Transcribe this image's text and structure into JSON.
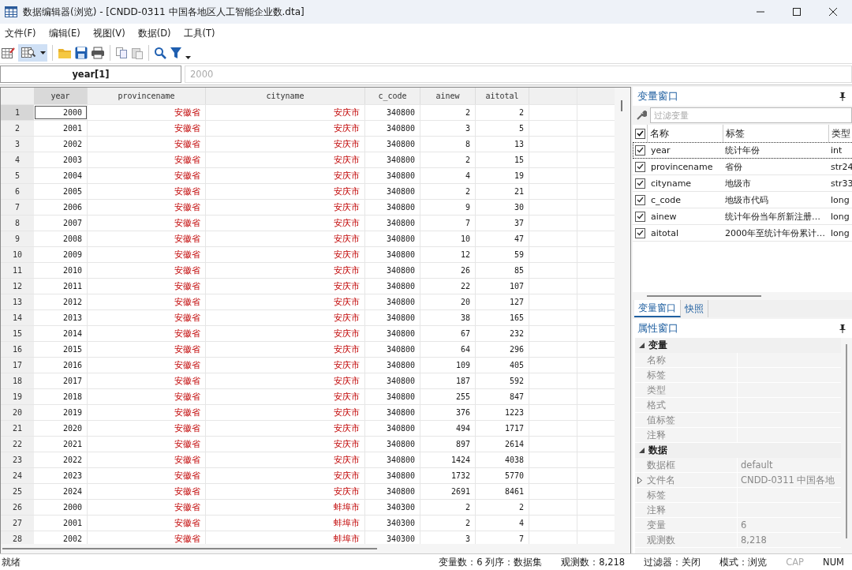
{
  "window": {
    "title": "数据编辑器(浏览) - [CNDD-0311 中国各地区人工智能企业数.dta]"
  },
  "menu": [
    "文件(F)",
    "编辑(E)",
    "视图(V)",
    "数据(D)",
    "工具(T)"
  ],
  "varbar": {
    "name": "year[1]",
    "value": "2000"
  },
  "grid": {
    "columns": [
      {
        "label": "year",
        "kind": "number",
        "selected": true
      },
      {
        "label": "provincename",
        "kind": "string",
        "selected": false
      },
      {
        "label": "cityname",
        "kind": "string",
        "selected": false
      },
      {
        "label": "c_code",
        "kind": "number",
        "selected": false
      },
      {
        "label": "ainew",
        "kind": "number",
        "selected": false
      },
      {
        "label": "aitotal",
        "kind": "number",
        "selected": false
      }
    ],
    "rows": [
      {
        "n": "1",
        "selected": true,
        "cells": [
          "2000",
          "安徽省",
          "安庆市",
          "340800",
          "2",
          "2"
        ]
      },
      {
        "n": "2",
        "selected": false,
        "cells": [
          "2001",
          "安徽省",
          "安庆市",
          "340800",
          "3",
          "5"
        ]
      },
      {
        "n": "3",
        "selected": false,
        "cells": [
          "2002",
          "安徽省",
          "安庆市",
          "340800",
          "8",
          "13"
        ]
      },
      {
        "n": "4",
        "selected": false,
        "cells": [
          "2003",
          "安徽省",
          "安庆市",
          "340800",
          "2",
          "15"
        ]
      },
      {
        "n": "5",
        "selected": false,
        "cells": [
          "2004",
          "安徽省",
          "安庆市",
          "340800",
          "4",
          "19"
        ]
      },
      {
        "n": "6",
        "selected": false,
        "cells": [
          "2005",
          "安徽省",
          "安庆市",
          "340800",
          "2",
          "21"
        ]
      },
      {
        "n": "7",
        "selected": false,
        "cells": [
          "2006",
          "安徽省",
          "安庆市",
          "340800",
          "9",
          "30"
        ]
      },
      {
        "n": "8",
        "selected": false,
        "cells": [
          "2007",
          "安徽省",
          "安庆市",
          "340800",
          "7",
          "37"
        ]
      },
      {
        "n": "9",
        "selected": false,
        "cells": [
          "2008",
          "安徽省",
          "安庆市",
          "340800",
          "10",
          "47"
        ]
      },
      {
        "n": "10",
        "selected": false,
        "cells": [
          "2009",
          "安徽省",
          "安庆市",
          "340800",
          "12",
          "59"
        ]
      },
      {
        "n": "11",
        "selected": false,
        "cells": [
          "2010",
          "安徽省",
          "安庆市",
          "340800",
          "26",
          "85"
        ]
      },
      {
        "n": "12",
        "selected": false,
        "cells": [
          "2011",
          "安徽省",
          "安庆市",
          "340800",
          "22",
          "107"
        ]
      },
      {
        "n": "13",
        "selected": false,
        "cells": [
          "2012",
          "安徽省",
          "安庆市",
          "340800",
          "20",
          "127"
        ]
      },
      {
        "n": "14",
        "selected": false,
        "cells": [
          "2013",
          "安徽省",
          "安庆市",
          "340800",
          "38",
          "165"
        ]
      },
      {
        "n": "15",
        "selected": false,
        "cells": [
          "2014",
          "安徽省",
          "安庆市",
          "340800",
          "67",
          "232"
        ]
      },
      {
        "n": "16",
        "selected": false,
        "cells": [
          "2015",
          "安徽省",
          "安庆市",
          "340800",
          "64",
          "296"
        ]
      },
      {
        "n": "17",
        "selected": false,
        "cells": [
          "2016",
          "安徽省",
          "安庆市",
          "340800",
          "109",
          "405"
        ]
      },
      {
        "n": "18",
        "selected": false,
        "cells": [
          "2017",
          "安徽省",
          "安庆市",
          "340800",
          "187",
          "592"
        ]
      },
      {
        "n": "19",
        "selected": false,
        "cells": [
          "2018",
          "安徽省",
          "安庆市",
          "340800",
          "255",
          "847"
        ]
      },
      {
        "n": "20",
        "selected": false,
        "cells": [
          "2019",
          "安徽省",
          "安庆市",
          "340800",
          "376",
          "1223"
        ]
      },
      {
        "n": "21",
        "selected": false,
        "cells": [
          "2020",
          "安徽省",
          "安庆市",
          "340800",
          "494",
          "1717"
        ]
      },
      {
        "n": "22",
        "selected": false,
        "cells": [
          "2021",
          "安徽省",
          "安庆市",
          "340800",
          "897",
          "2614"
        ]
      },
      {
        "n": "23",
        "selected": false,
        "cells": [
          "2022",
          "安徽省",
          "安庆市",
          "340800",
          "1424",
          "4038"
        ]
      },
      {
        "n": "24",
        "selected": false,
        "cells": [
          "2023",
          "安徽省",
          "安庆市",
          "340800",
          "1732",
          "5770"
        ]
      },
      {
        "n": "25",
        "selected": false,
        "cells": [
          "2024",
          "安徽省",
          "安庆市",
          "340800",
          "2691",
          "8461"
        ]
      },
      {
        "n": "26",
        "selected": false,
        "cells": [
          "2000",
          "安徽省",
          "蚌埠市",
          "340300",
          "2",
          "2"
        ]
      },
      {
        "n": "27",
        "selected": false,
        "cells": [
          "2001",
          "安徽省",
          "蚌埠市",
          "340300",
          "2",
          "4"
        ]
      },
      {
        "n": "28",
        "selected": false,
        "cells": [
          "2002",
          "安徽省",
          "蚌埠市",
          "340300",
          "3",
          "7"
        ]
      }
    ]
  },
  "variables": {
    "title": "变量窗口",
    "filter_placeholder": "过滤变量",
    "all_checked": true,
    "headers": [
      "名称",
      "标签",
      "类型"
    ],
    "items": [
      {
        "name": "year",
        "label": "统计年份",
        "type": "int",
        "checked": true,
        "selected": true
      },
      {
        "name": "provincename",
        "label": "省份",
        "type": "str24",
        "checked": true,
        "selected": false
      },
      {
        "name": "cityname",
        "label": "地级市",
        "type": "str33",
        "checked": true,
        "selected": false
      },
      {
        "name": "c_code",
        "label": "地级市代码",
        "type": "long",
        "checked": true,
        "selected": false
      },
      {
        "name": "ainew",
        "label": "统计年份当年所新注册…",
        "type": "long",
        "checked": true,
        "selected": false
      },
      {
        "name": "aitotal",
        "label": "2000年至统计年份累计…",
        "type": "long",
        "checked": true,
        "selected": false
      }
    ],
    "tabs": [
      {
        "label": "变量窗口",
        "selected": true
      },
      {
        "label": "快照",
        "selected": false
      }
    ]
  },
  "properties": {
    "title": "属性窗口",
    "groups": [
      {
        "name": "变量",
        "items": [
          {
            "name": "名称",
            "kind": "plain"
          },
          {
            "name": "标签",
            "kind": "plain"
          },
          {
            "name": "类型",
            "kind": "plain"
          },
          {
            "name": "格式",
            "kind": "plain"
          },
          {
            "name": "值标签",
            "kind": "plain"
          },
          {
            "name": "注释",
            "kind": "plain"
          }
        ]
      },
      {
        "name": "数据",
        "items": [
          {
            "name": "数据框",
            "value": "default",
            "kind": "plain"
          },
          {
            "name": "文件名",
            "value": "CNDD-0311 中国各地",
            "kind": "node"
          },
          {
            "name": "标签",
            "kind": "plain"
          },
          {
            "name": "注释",
            "kind": "plain"
          },
          {
            "name": "变量",
            "value": "6",
            "kind": "plain"
          },
          {
            "name": "观测数",
            "value": "8,218",
            "kind": "plain"
          }
        ]
      }
    ]
  },
  "status_bar": {
    "left": "就绪",
    "items": [
      {
        "text": "变量数：6  列序：数据集",
        "disabled": false
      },
      {
        "text": "观测数：8,218",
        "disabled": false
      },
      {
        "text": "过滤器：关闭",
        "disabled": false
      },
      {
        "text": "模式：浏览",
        "disabled": false
      },
      {
        "text": "CAP",
        "disabled": true
      },
      {
        "text": "NUM",
        "disabled": false
      }
    ]
  }
}
